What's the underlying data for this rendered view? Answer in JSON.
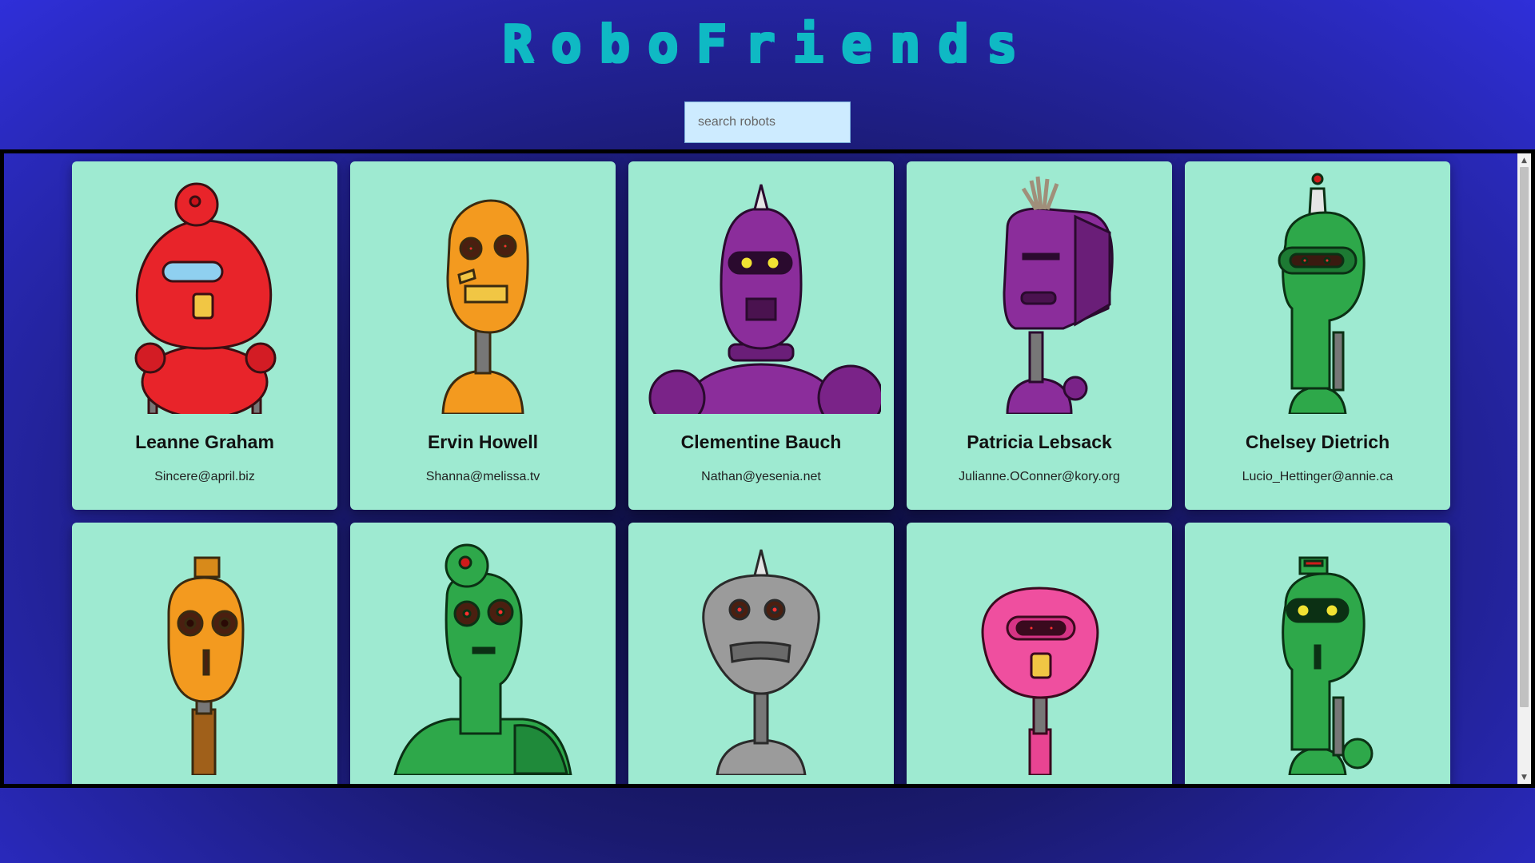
{
  "app": {
    "title": "RoboFriends"
  },
  "search": {
    "placeholder": "search robots"
  },
  "robots": [
    {
      "name": "Leanne Graham",
      "email": "Sincere@april.biz",
      "color": "#e8242a"
    },
    {
      "name": "Ervin Howell",
      "email": "Shanna@melissa.tv",
      "color": "#f39a1f"
    },
    {
      "name": "Clementine Bauch",
      "email": "Nathan@yesenia.net",
      "color": "#8b2d9b"
    },
    {
      "name": "Patricia Lebsack",
      "email": "Julianne.OConner@kory.org",
      "color": "#8b2d9b"
    },
    {
      "name": "Chelsey Dietrich",
      "email": "Lucio_Hettinger@annie.ca",
      "color": "#2ea84a"
    },
    {
      "name": "",
      "email": "",
      "color": "#f39a1f"
    },
    {
      "name": "",
      "email": "",
      "color": "#2ea84a"
    },
    {
      "name": "",
      "email": "",
      "color": "#9b9b9b"
    },
    {
      "name": "",
      "email": "",
      "color": "#ef4f9f"
    },
    {
      "name": "",
      "email": "",
      "color": "#2ea84a"
    }
  ],
  "scrollbar": {
    "up_glyph": "▲",
    "down_glyph": "▼"
  }
}
